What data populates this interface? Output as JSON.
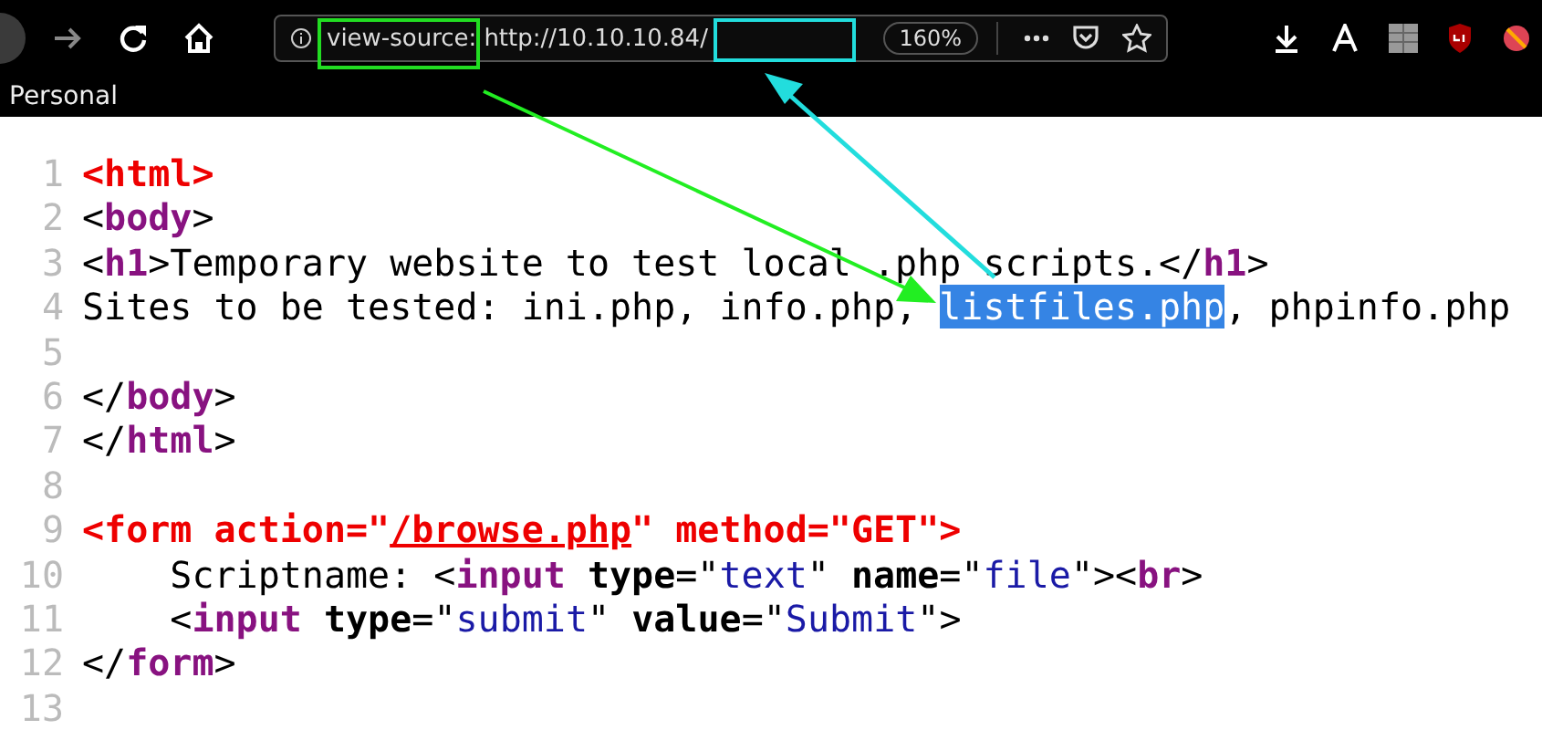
{
  "toolbar": {
    "url_scheme": "view-source:",
    "url": "http://10.10.10.84/",
    "zoom": "160%",
    "bookmarks": [
      "Personal"
    ]
  },
  "source_lines": [
    {
      "number": "1",
      "tokens": [
        {
          "kind": "error",
          "text": "<html>"
        }
      ]
    },
    {
      "number": "2",
      "tokens": [
        {
          "kind": "plain",
          "text": "<"
        },
        {
          "kind": "tag",
          "text": "body"
        },
        {
          "kind": "plain",
          "text": ">"
        }
      ]
    },
    {
      "number": "3",
      "tokens": [
        {
          "kind": "plain",
          "text": "<"
        },
        {
          "kind": "tag",
          "text": "h1"
        },
        {
          "kind": "plain",
          "text": ">Temporary website to test local .php scripts.</"
        },
        {
          "kind": "tag",
          "text": "h1"
        },
        {
          "kind": "plain",
          "text": ">"
        }
      ]
    },
    {
      "number": "4",
      "tokens": [
        {
          "kind": "plain",
          "text": "Sites to be tested: ini.php, info.php, "
        },
        {
          "kind": "selected",
          "text": "listfiles.php"
        },
        {
          "kind": "plain",
          "text": ", phpinfo.php"
        }
      ]
    },
    {
      "number": "5"
    },
    {
      "number": "6",
      "tokens": [
        {
          "kind": "plain",
          "text": "</"
        },
        {
          "kind": "tag",
          "text": "body"
        },
        {
          "kind": "plain",
          "text": ">"
        }
      ]
    },
    {
      "number": "7",
      "tokens": [
        {
          "kind": "plain",
          "text": "</"
        },
        {
          "kind": "tag",
          "text": "html"
        },
        {
          "kind": "plain",
          "text": ">"
        }
      ]
    },
    {
      "number": "8"
    },
    {
      "number": "9",
      "tokens": [
        {
          "kind": "error",
          "text": "<form action=\""
        },
        {
          "kind": "error_link",
          "text": "/browse.php"
        },
        {
          "kind": "error",
          "text": "\" method=\"GET\">"
        }
      ]
    },
    {
      "number": "10",
      "tokens": [
        {
          "kind": "plain",
          "text": "    Scriptname: <"
        },
        {
          "kind": "tag",
          "text": "input"
        },
        {
          "kind": "attr",
          "text": " type"
        },
        {
          "kind": "plain",
          "text": "=\""
        },
        {
          "kind": "value",
          "text": "text"
        },
        {
          "kind": "plain",
          "text": "\" "
        },
        {
          "kind": "attr",
          "text": "name"
        },
        {
          "kind": "plain",
          "text": "=\""
        },
        {
          "kind": "value",
          "text": "file"
        },
        {
          "kind": "plain",
          "text": "\"><"
        },
        {
          "kind": "tag",
          "text": "br"
        },
        {
          "kind": "plain",
          "text": ">"
        }
      ]
    },
    {
      "number": "11",
      "tokens": [
        {
          "kind": "plain",
          "text": "    <"
        },
        {
          "kind": "tag",
          "text": "input"
        },
        {
          "kind": "attr",
          "text": " type"
        },
        {
          "kind": "plain",
          "text": "=\""
        },
        {
          "kind": "value",
          "text": "submit"
        },
        {
          "kind": "plain",
          "text": "\" "
        },
        {
          "kind": "attr",
          "text": "value"
        },
        {
          "kind": "plain",
          "text": "=\""
        },
        {
          "kind": "value",
          "text": "Submit"
        },
        {
          "kind": "plain",
          "text": "\">"
        }
      ]
    },
    {
      "number": "12",
      "tokens": [
        {
          "kind": "plain",
          "text": "</"
        },
        {
          "kind": "tag",
          "text": "form"
        },
        {
          "kind": "plain",
          "text": ">"
        }
      ]
    },
    {
      "number": "13"
    }
  ]
}
